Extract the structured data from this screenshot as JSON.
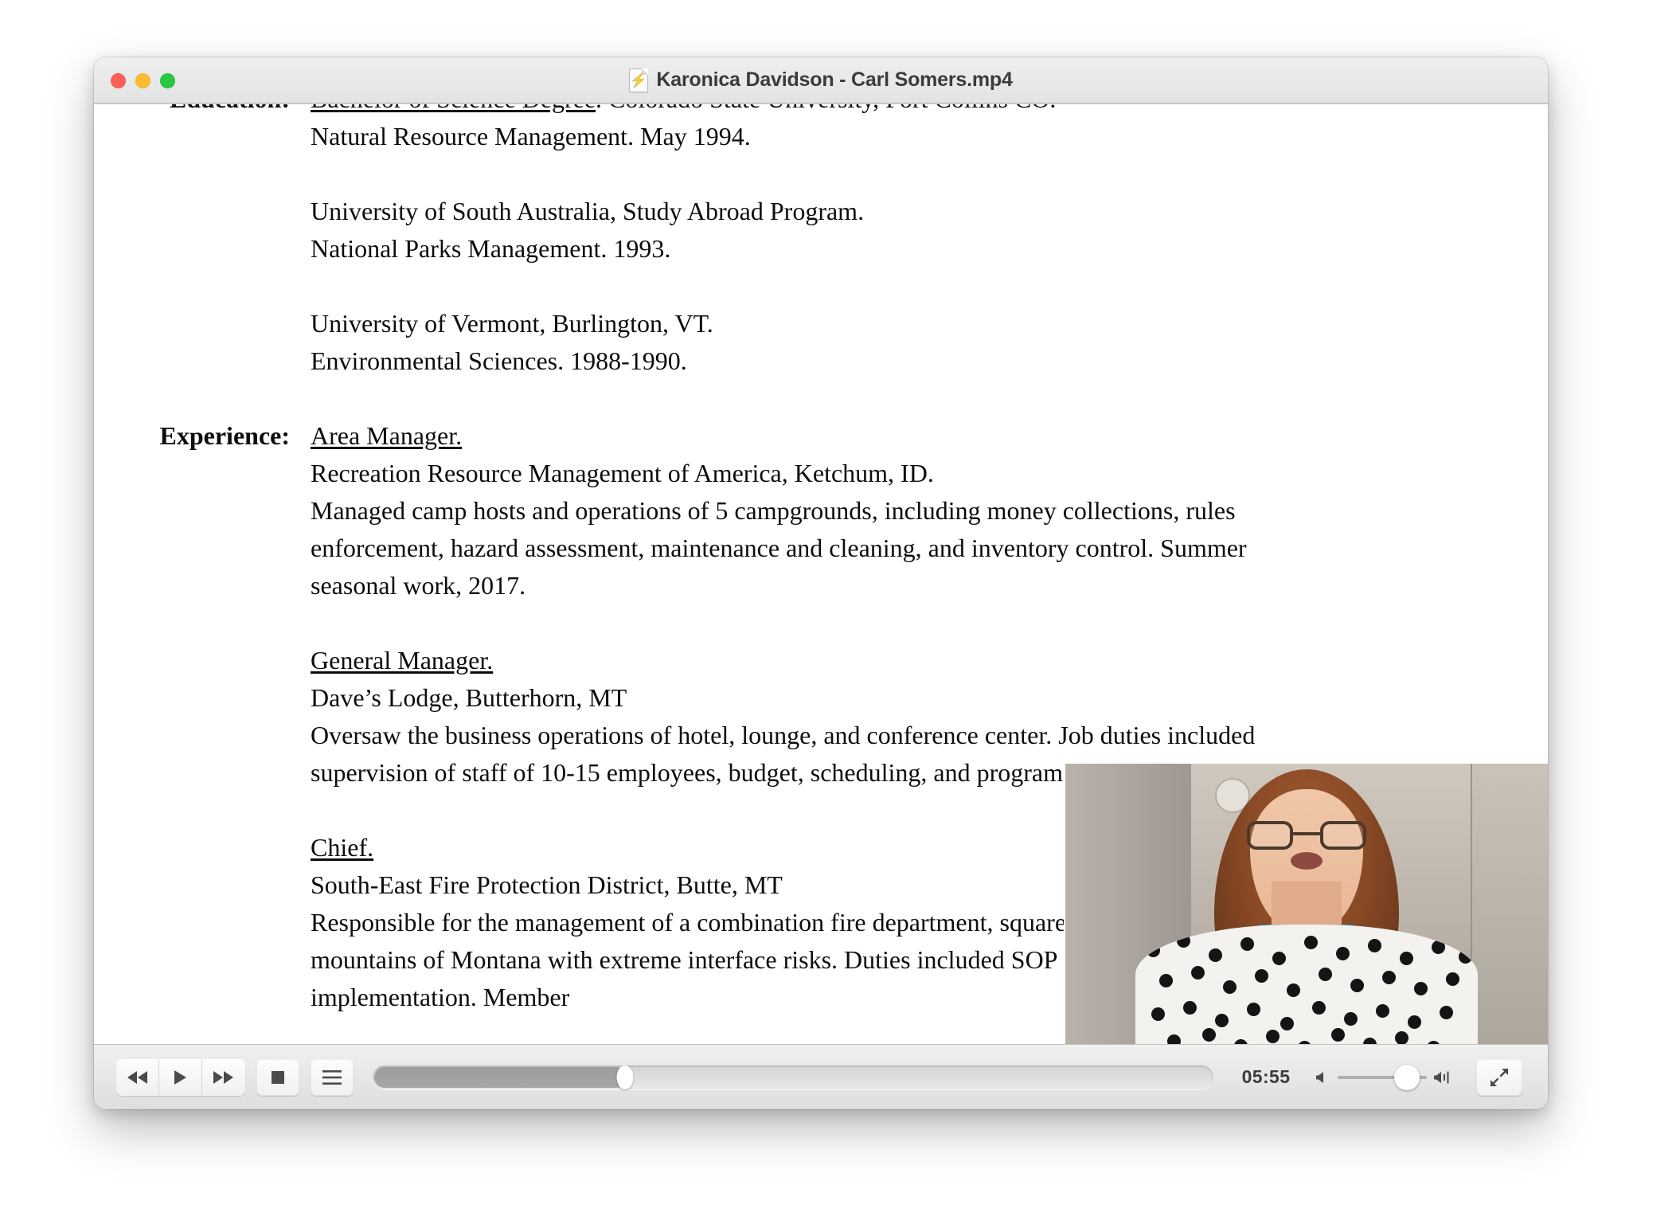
{
  "window": {
    "title": "Karonica Davidson - Carl Somers.mp4",
    "title_icon": "quicktime-document-icon",
    "traffic_lights": {
      "close_label": "close",
      "minimize_label": "minimize",
      "maximize_label": "maximize",
      "close_color": "#ff5f57",
      "minimize_color": "#febc2e",
      "maximize_color": "#28c840"
    }
  },
  "document": {
    "sections": [
      {
        "label": "Education:",
        "blocks": [
          {
            "lines": [
              {
                "text": "Bachelor of Science Degree",
                "underline": true,
                "suffix": ".  Colorado State University, Fort Collins CO."
              },
              {
                "text": "Natural Resource Management.  May 1994.",
                "underline": false
              }
            ]
          },
          {
            "lines": [
              {
                "text": "University of South Australia, Study Abroad Program.",
                "underline": false
              },
              {
                "text": "National Parks Management.  1993.",
                "underline": false
              }
            ]
          },
          {
            "lines": [
              {
                "text": "University of Vermont, Burlington, VT.",
                "underline": false
              },
              {
                "text": "Environmental Sciences.  1988-1990.",
                "underline": false
              }
            ]
          }
        ]
      },
      {
        "label": "Experience:",
        "blocks": [
          {
            "lines": [
              {
                "text": "Area Manager.",
                "underline": true
              },
              {
                "text": "Recreation Resource Management of America, Ketchum, ID.",
                "underline": false
              },
              {
                "text": "Managed camp hosts and operations of 5 campgrounds, including money collections, rules enforcement, hazard assessment, maintenance and cleaning, and inventory control. Summer seasonal work, 2017.",
                "underline": false,
                "wrap": true
              }
            ]
          },
          {
            "lines": [
              {
                "text": "General Manager.",
                "underline": true
              },
              {
                "text": "Dave’s Lodge, Butterhorn, MT",
                "underline": false
              },
              {
                "text": "Oversaw the business operations of hotel, lounge, and conference center. Job duties included supervision of staff of 10-15 employees, budget, scheduling, and programs specializing in hotel",
                "underline": false,
                "wrap": true
              }
            ]
          },
          {
            "lines": [
              {
                "text": "Chief.",
                "underline": true
              },
              {
                "text": "South-East Fire Protection District, Butte, MT",
                "underline": false
              },
              {
                "text": "Responsible for the management of a combination fire department, square miles in the rural mountains of Montana with extreme interface risks. Duties included SOP development and implementation. Member",
                "underline": false,
                "wrap": true
              }
            ]
          }
        ]
      }
    ]
  },
  "controls": {
    "rewind_label": "Rewind",
    "play_label": "Play",
    "fastforward_label": "Fast forward",
    "stop_label": "Stop",
    "playlist_label": "Playlist",
    "time_remaining": "05:55",
    "scrubber_position_percent": 30,
    "volume_percent": 78,
    "volume_low_icon": "speaker-low-icon",
    "volume_high_icon": "speaker-high-icon",
    "fullscreen_label": "Full screen"
  },
  "pip": {
    "label": "picture-in-picture-video",
    "description": "Woman with glasses speaking on webcam"
  }
}
